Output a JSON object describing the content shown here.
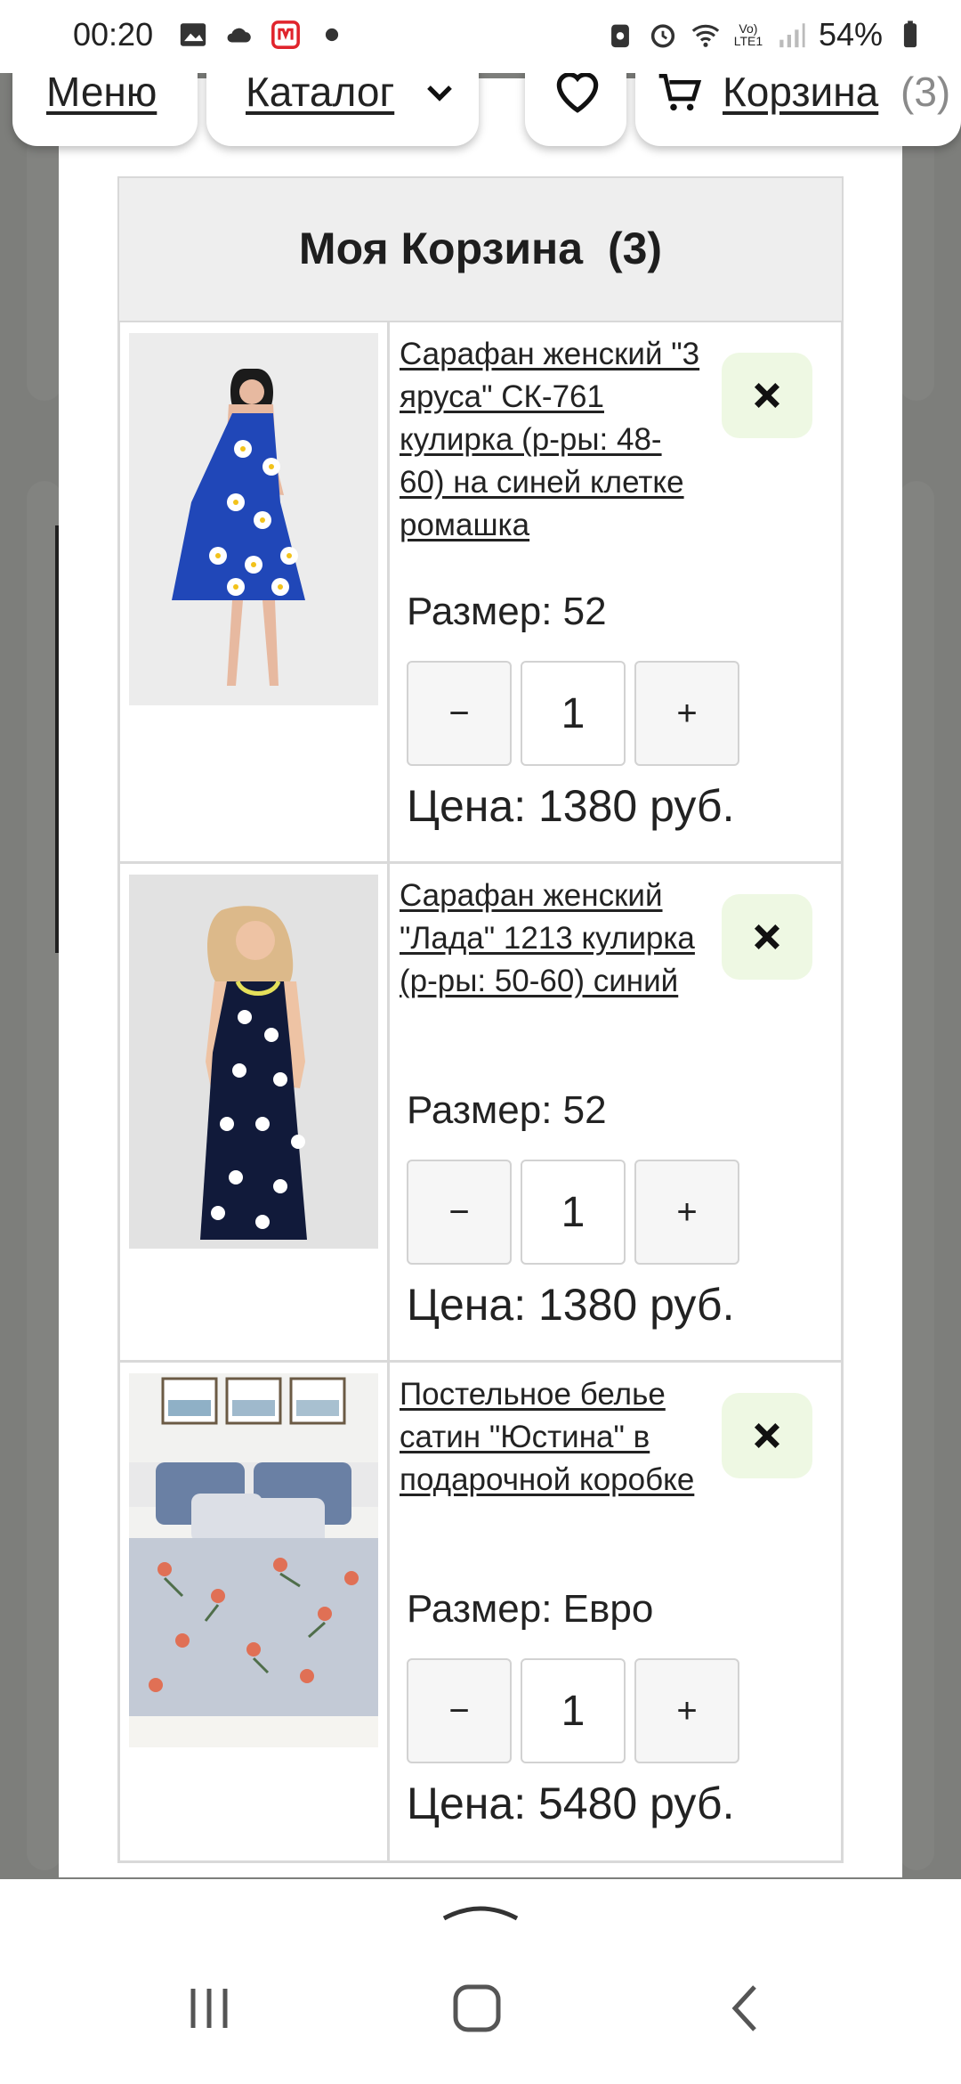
{
  "status_bar": {
    "time": "00:20",
    "battery": "54%",
    "network": "Vo) LTE1"
  },
  "header": {
    "menu_label": "Меню",
    "catalog_label": "Каталог",
    "favorites_count": "0",
    "cart_label": "Корзина",
    "cart_count": "(3)"
  },
  "cart": {
    "title": "Моя Корзина",
    "count": "(3)",
    "items": [
      {
        "name": "Сарафан женский \"3 яруса\" СК-761 кулирка (р-ры: 48-60) на синей клетке ромашка",
        "size": "Размер: 52",
        "qty": "1",
        "price": "Цена: 1380 руб."
      },
      {
        "name": "Сарафан женский \"Лада\" 1213 кулирка (р-ры: 50-60) синий",
        "size": "Размер: 52",
        "qty": "1",
        "price": "Цена: 1380 руб."
      },
      {
        "name": "Постельное белье сатин \"Юстина\" в подарочной коробке",
        "size": "Размер: Евро",
        "qty": "1",
        "price": "Цена: 5480 руб."
      }
    ],
    "minus_label": "−",
    "plus_label": "+"
  },
  "colors": {
    "remove_bg": "#eef8e3",
    "header_bg": "#eeeeee",
    "dim_overlay": "#7d7e7b"
  },
  "icons": [
    "gallery-icon",
    "cloud-icon",
    "app-icon",
    "dot-icon",
    "heart-icon",
    "cart-icon",
    "chevron-down-icon",
    "close-icon"
  ]
}
